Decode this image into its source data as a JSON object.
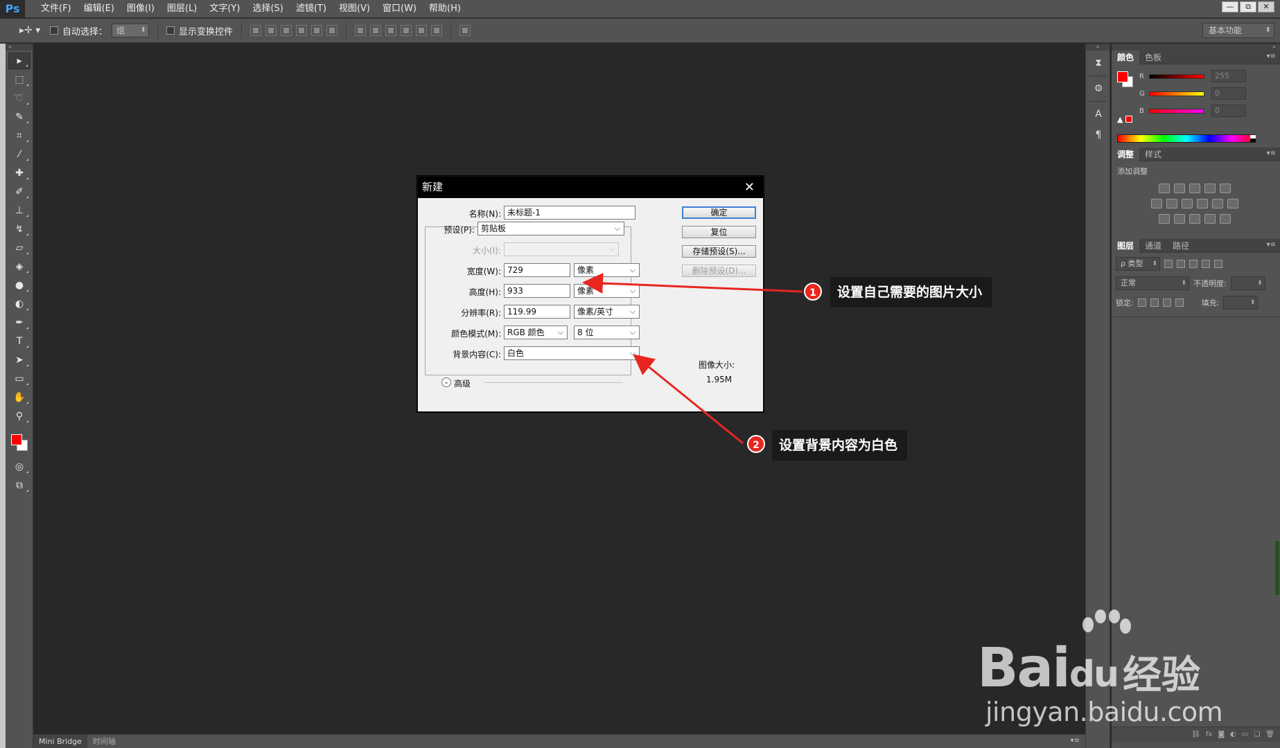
{
  "app": {
    "logo": "Ps",
    "menus": [
      "文件(F)",
      "编辑(E)",
      "图像(I)",
      "图层(L)",
      "文字(Y)",
      "选择(S)",
      "滤镜(T)",
      "视图(V)",
      "窗口(W)",
      "帮助(H)"
    ],
    "window_controls": [
      "—",
      "⧉",
      "✕"
    ]
  },
  "options_bar": {
    "auto_select_label": "自动选择：",
    "auto_select_value": "组",
    "show_transform_label": "显示变换控件",
    "workspace": "基本功能"
  },
  "bottom_tabs": [
    "Mini Bridge",
    "时间轴"
  ],
  "right_panels": {
    "color_tabs": [
      "颜色",
      "色板"
    ],
    "color_channels": [
      {
        "letter": "R",
        "value": "255"
      },
      {
        "letter": "G",
        "value": "0"
      },
      {
        "letter": "B",
        "value": "0"
      }
    ],
    "adjust_tabs": [
      "调整",
      "样式"
    ],
    "adjust_title": "添加调整",
    "layer_tabs": [
      "图层",
      "通道",
      "路径"
    ],
    "kind_label": "ρ 类型",
    "blend_mode": "正常",
    "opacity_label": "不透明度:",
    "lock_label": "锁定:",
    "fill_label": "填充:"
  },
  "dialog": {
    "title": "新建",
    "close": "✕",
    "name_label": "名称(N):",
    "name_value": "未标题-1",
    "preset_label": "预设(P):",
    "preset_value": "剪贴板",
    "size_label": "大小(I):",
    "width_label": "宽度(W):",
    "width_value": "729",
    "width_unit": "像素",
    "height_label": "高度(H):",
    "height_value": "933",
    "height_unit": "像素",
    "resolution_label": "分辨率(R):",
    "resolution_value": "119.99",
    "resolution_unit": "像素/英寸",
    "color_mode_label": "颜色模式(M):",
    "color_mode_value": "RGB 颜色",
    "bit_depth_value": "8 位",
    "background_label": "背景内容(C):",
    "background_value": "白色",
    "advanced_label": "高级",
    "buttons": {
      "ok": "确定",
      "reset": "复位",
      "save_preset": "存储预设(S)...",
      "delete_preset": "删除预设(D)..."
    },
    "image_size_label": "图像大小:",
    "image_size_value": "1.95M"
  },
  "annotations": [
    {
      "number": "1",
      "text": "设置自己需要的图片大小"
    },
    {
      "number": "2",
      "text": "设置背景内容为白色"
    }
  ],
  "watermark": {
    "brand": "Bai",
    "brand_suffix": "du",
    "cn": "经验",
    "url": "jingyan.baidu.com"
  },
  "colors": {
    "foreground": "#ff0000",
    "background": "#ffffff",
    "arrow": "#e8261f"
  }
}
